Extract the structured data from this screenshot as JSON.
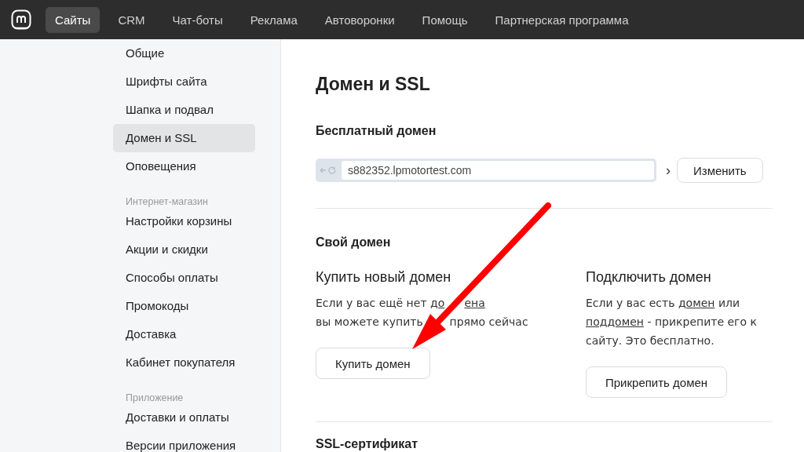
{
  "top_nav": {
    "items": [
      {
        "label": "Сайты",
        "selected": true
      },
      {
        "label": "CRM",
        "selected": false
      },
      {
        "label": "Чат-боты",
        "selected": false
      },
      {
        "label": "Реклама",
        "selected": false
      },
      {
        "label": "Автоворонки",
        "selected": false
      },
      {
        "label": "Помощь",
        "selected": false
      },
      {
        "label": "Партнерская программа",
        "selected": false
      }
    ]
  },
  "sidebar": {
    "groups": [
      {
        "items": [
          {
            "label": "Общие",
            "selected": false
          },
          {
            "label": "Шрифты сайта",
            "selected": false
          },
          {
            "label": "Шапка и подвал",
            "selected": false
          },
          {
            "label": "Домен и SSL",
            "selected": true
          },
          {
            "label": "Оповещения",
            "selected": false
          }
        ]
      },
      {
        "heading": "Интернет-магазин",
        "items": [
          {
            "label": "Настройки корзины",
            "selected": false
          },
          {
            "label": "Акции и скидки",
            "selected": false
          },
          {
            "label": "Способы оплаты",
            "selected": false
          },
          {
            "label": "Промокоды",
            "selected": false
          },
          {
            "label": "Доставка",
            "selected": false
          },
          {
            "label": "Кабинет покупателя",
            "selected": false
          }
        ]
      },
      {
        "heading": "Приложение",
        "items": [
          {
            "label": "Доставки и оплаты",
            "selected": false
          },
          {
            "label": "Версии приложения",
            "selected": false
          }
        ]
      }
    ]
  },
  "main": {
    "title": "Домен и SSL",
    "free_domain": {
      "heading": "Бесплатный домен",
      "address": "s882352.lpmotortest.com",
      "chevron": "›",
      "button": "Изменить"
    },
    "own_domain": {
      "heading": "Свой домен",
      "columns": [
        {
          "title": "Купить новый домен",
          "lines": [
            [
              {
                "text": "Если у вас ещё нет ",
                "link": false
              },
              {
                "text": "до",
                "link": true,
                "hidden_after": true
              },
              {
                "text": "ена",
                "link": true
              }
            ],
            [
              {
                "text": "вы можете купить ",
                "link": false,
                "hidden_after": true
              },
              {
                "text": "прямо сейчас",
                "link": false
              }
            ]
          ],
          "button": "Купить домен"
        },
        {
          "title": "Подключить домен",
          "lines": [
            [
              {
                "text": "Если у вас есть ",
                "link": false
              },
              {
                "text": "домен",
                "link": true
              },
              {
                "text": " или ",
                "link": false
              },
              {
                "text": "поддомен",
                "link": true
              },
              {
                "text": " - прикрепите его к сайту. Это бесплатно.",
                "link": false
              }
            ]
          ],
          "button": "Прикрепить домен"
        }
      ]
    },
    "ssl": {
      "heading": "SSL-сертификат"
    }
  }
}
